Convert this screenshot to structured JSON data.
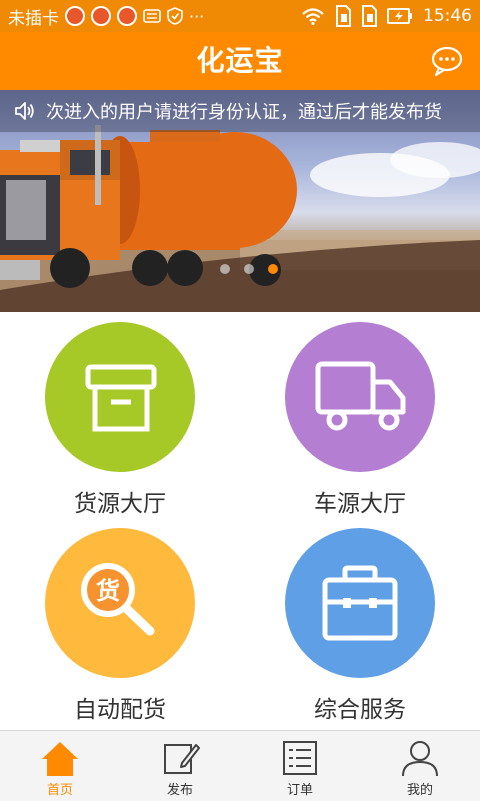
{
  "status_bar": {
    "carrier": "未插卡",
    "more": "···",
    "time": "15:46"
  },
  "header": {
    "title": "化运宝"
  },
  "banner": {
    "notice": "次进入的用户请进行身份认证，通过后才能发布货",
    "active_slide": 3,
    "slide_count": 3
  },
  "grid": [
    {
      "label": "货源大厅",
      "color": "#a6c927",
      "icon": "box-icon"
    },
    {
      "label": "车源大厅",
      "color": "#b47ed2",
      "icon": "truck-icon"
    },
    {
      "label": "自动配货",
      "color": "#ffb93c",
      "icon": "magnifier-icon",
      "badge": "货"
    },
    {
      "label": "综合服务",
      "color": "#5f9fe6",
      "icon": "briefcase-icon"
    }
  ],
  "tabs": [
    {
      "label": "首页",
      "icon": "home-icon",
      "active": true
    },
    {
      "label": "发布",
      "icon": "edit-icon",
      "active": false
    },
    {
      "label": "订单",
      "icon": "list-icon",
      "active": false
    },
    {
      "label": "我的",
      "icon": "user-icon",
      "active": false
    }
  ],
  "colors": {
    "accent": "#ff8a00",
    "status_bar": "#f08a05"
  }
}
